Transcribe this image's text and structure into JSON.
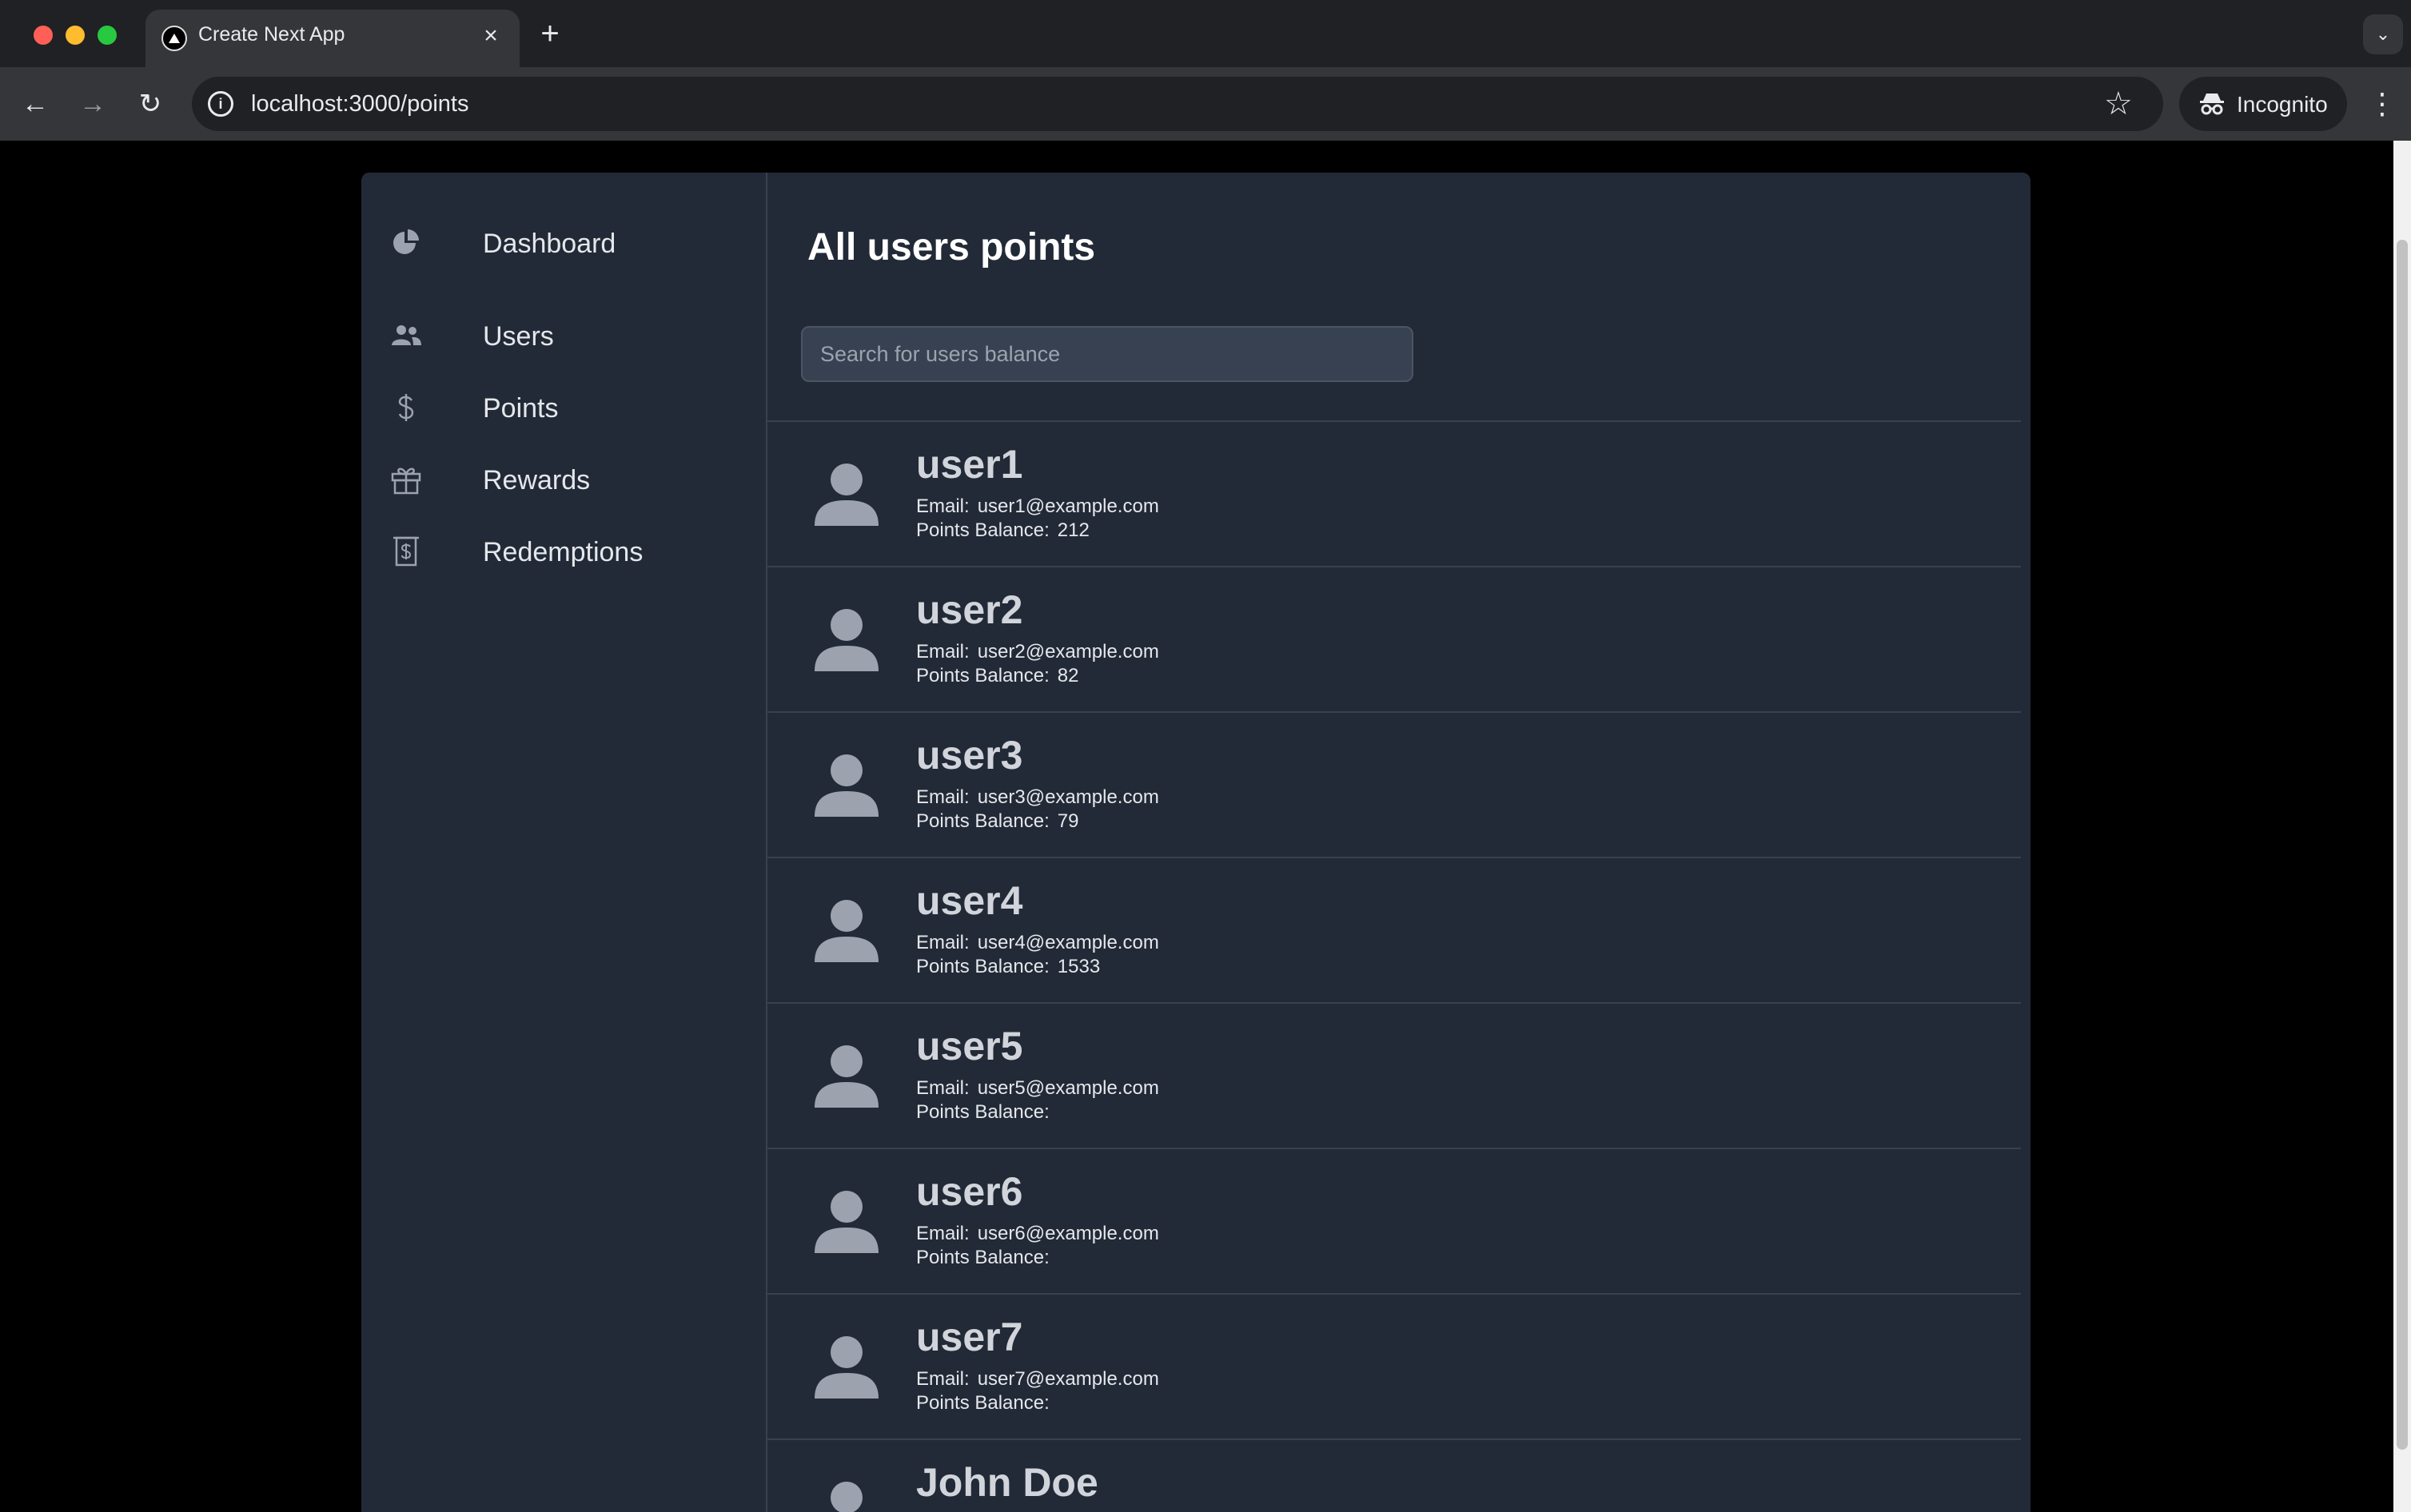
{
  "browser": {
    "tab_title": "Create Next App",
    "url": "localhost:3000/points",
    "incognito_label": "Incognito"
  },
  "sidebar": {
    "items": [
      {
        "label": "Dashboard",
        "icon": "pie-chart-icon"
      },
      {
        "label": "Users",
        "icon": "users-icon"
      },
      {
        "label": "Points",
        "icon": "dollar-icon"
      },
      {
        "label": "Rewards",
        "icon": "gift-icon"
      },
      {
        "label": "Redemptions",
        "icon": "receipt-icon"
      }
    ]
  },
  "main": {
    "title": "All users points",
    "search_placeholder": "Search for users balance",
    "email_label": "Email:",
    "points_label": "Points Balance:",
    "users": [
      {
        "name": "user1",
        "email": "user1@example.com",
        "points": "212"
      },
      {
        "name": "user2",
        "email": "user2@example.com",
        "points": "82"
      },
      {
        "name": "user3",
        "email": "user3@example.com",
        "points": "79"
      },
      {
        "name": "user4",
        "email": "user4@example.com",
        "points": "1533"
      },
      {
        "name": "user5",
        "email": "user5@example.com",
        "points": ""
      },
      {
        "name": "user6",
        "email": "user6@example.com",
        "points": ""
      },
      {
        "name": "user7",
        "email": "user7@example.com",
        "points": ""
      },
      {
        "name": "John Doe",
        "email": "",
        "points": ""
      }
    ]
  },
  "colors": {
    "app_bg": "#222a37",
    "border": "#374151",
    "avatar": "#9ca3af"
  }
}
